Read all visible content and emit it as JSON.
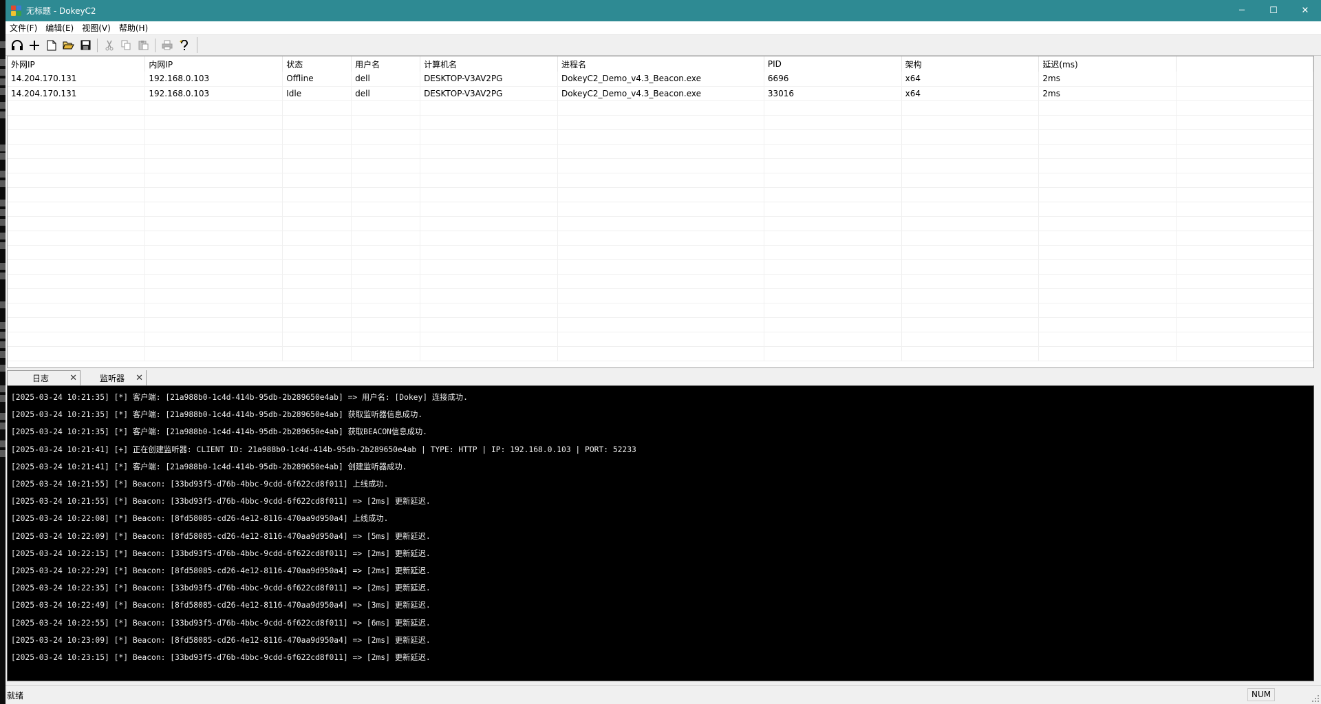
{
  "window": {
    "title": "无标题 - DokeyC2",
    "controls": {
      "minimize": "─",
      "maximize": "☐",
      "close": "✕"
    }
  },
  "menu": [
    "文件(F)",
    "编辑(E)",
    "视图(V)",
    "帮助(H)"
  ],
  "toolbar": {
    "icons": [
      "headset-icon",
      "plus-icon",
      "new-file-icon",
      "open-folder-icon",
      "save-icon",
      "cut-icon",
      "copy-icon",
      "paste-icon",
      "print-icon",
      "help-icon"
    ]
  },
  "table": {
    "columns": [
      "外网IP",
      "内网IP",
      "状态",
      "用户名",
      "计算机名",
      "进程名",
      "PID",
      "架构",
      "延迟(ms)"
    ],
    "rows": [
      [
        "14.204.170.131",
        "192.168.0.103",
        "Offline",
        "dell",
        "DESKTOP-V3AV2PG",
        "DokeyC2_Demo_v4.3_Beacon.exe",
        "6696",
        "x64",
        "2ms"
      ],
      [
        "14.204.170.131",
        "192.168.0.103",
        "Idle",
        "dell",
        "DESKTOP-V3AV2PG",
        "DokeyC2_Demo_v4.3_Beacon.exe",
        "33016",
        "x64",
        "2ms"
      ]
    ]
  },
  "tabs": [
    {
      "label": "日志",
      "close": "✕"
    },
    {
      "label": "监听器",
      "close": "✕"
    }
  ],
  "log": [
    "[2025-03-24 10:21:35] [*] 客户端: [21a988b0-1c4d-414b-95db-2b289650e4ab] => 用户名: [Dokey] 连接成功.",
    "[2025-03-24 10:21:35] [*] 客户端: [21a988b0-1c4d-414b-95db-2b289650e4ab] 获取监听器信息成功.",
    "[2025-03-24 10:21:35] [*] 客户端: [21a988b0-1c4d-414b-95db-2b289650e4ab] 获取BEACON信息成功.",
    "[2025-03-24 10:21:41] [+] 正在创建监听器: CLIENT ID: 21a988b0-1c4d-414b-95db-2b289650e4ab | TYPE: HTTP | IP: 192.168.0.103 | PORT: 52233",
    "[2025-03-24 10:21:41] [*] 客户端: [21a988b0-1c4d-414b-95db-2b289650e4ab] 创建监听器成功.",
    "[2025-03-24 10:21:55] [*] Beacon: [33bd93f5-d76b-4bbc-9cdd-6f622cd8f011] 上线成功.",
    "[2025-03-24 10:21:55] [*] Beacon: [33bd93f5-d76b-4bbc-9cdd-6f622cd8f011] => [2ms] 更新延迟.",
    "[2025-03-24 10:22:08] [*] Beacon: [8fd58085-cd26-4e12-8116-470aa9d950a4] 上线成功.",
    "[2025-03-24 10:22:09] [*] Beacon: [8fd58085-cd26-4e12-8116-470aa9d950a4] => [5ms] 更新延迟.",
    "[2025-03-24 10:22:15] [*] Beacon: [33bd93f5-d76b-4bbc-9cdd-6f622cd8f011] => [2ms] 更新延迟.",
    "[2025-03-24 10:22:29] [*] Beacon: [8fd58085-cd26-4e12-8116-470aa9d950a4] => [2ms] 更新延迟.",
    "[2025-03-24 10:22:35] [*] Beacon: [33bd93f5-d76b-4bbc-9cdd-6f622cd8f011] => [2ms] 更新延迟.",
    "[2025-03-24 10:22:49] [*] Beacon: [8fd58085-cd26-4e12-8116-470aa9d950a4] => [3ms] 更新延迟.",
    "[2025-03-24 10:22:55] [*] Beacon: [33bd93f5-d76b-4bbc-9cdd-6f622cd8f011] => [6ms] 更新延迟.",
    "[2025-03-24 10:23:09] [*] Beacon: [8fd58085-cd26-4e12-8116-470aa9d950a4] => [2ms] 更新延迟.",
    "[2025-03-24 10:23:15] [*] Beacon: [33bd93f5-d76b-4bbc-9cdd-6f622cd8f011] => [2ms] 更新延迟."
  ],
  "status": {
    "text": "就绪",
    "num": "NUM"
  },
  "colors": {
    "titlebar": "#2e8a93",
    "console_bg": "#000000",
    "console_text": "#f0f0f0"
  }
}
